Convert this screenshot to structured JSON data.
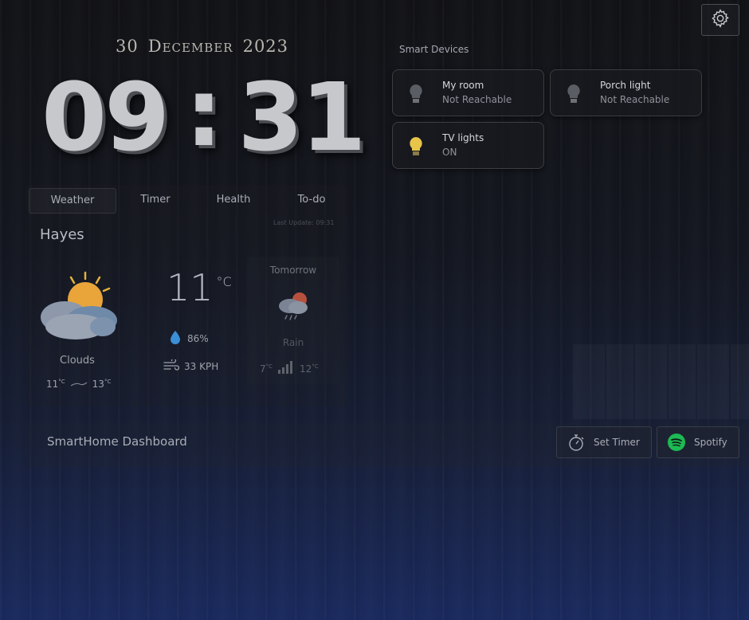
{
  "date": {
    "day": "30",
    "month": "December",
    "year": "2023"
  },
  "clock": {
    "hours": "09",
    "separator": ":",
    "minutes": "31"
  },
  "tabs": [
    {
      "label": "Weather",
      "active": true
    },
    {
      "label": "Timer",
      "active": false
    },
    {
      "label": "Health",
      "active": false
    },
    {
      "label": "To-do",
      "active": false
    }
  ],
  "weather": {
    "last_update": "Last Update: 09:31",
    "city": "Hayes",
    "condition": "Clouds",
    "temp": "11",
    "temp_unit": "°C",
    "min": "11",
    "max": "13",
    "unit_small": "°C",
    "humidity": "86%",
    "wind": "33 KPH",
    "icons": {
      "main": "sun-behind-clouds-icon",
      "humidity": "droplet-icon",
      "wind": "wind-icon"
    }
  },
  "tomorrow": {
    "label": "Tomorrow",
    "condition": "Rain",
    "min": "7",
    "max": "12",
    "unit": "°C",
    "icon": "rain-cloud-icon"
  },
  "smart_devices": {
    "title": "Smart Devices",
    "devices": [
      {
        "name": "My room",
        "status": "Not Reachable",
        "on": false
      },
      {
        "name": "Porch light",
        "status": "Not Reachable",
        "on": false
      },
      {
        "name": "TV lights",
        "status": "ON",
        "on": true
      }
    ]
  },
  "footer": {
    "title": "SmartHome Dashboard",
    "timer_button": "Set Timer",
    "spotify_button": "Spotify"
  },
  "colors": {
    "bulb_on": "#e7c44a",
    "bulb_off": "#5a5d63",
    "spotify": "#1db954",
    "droplet": "#3a8fd6"
  }
}
